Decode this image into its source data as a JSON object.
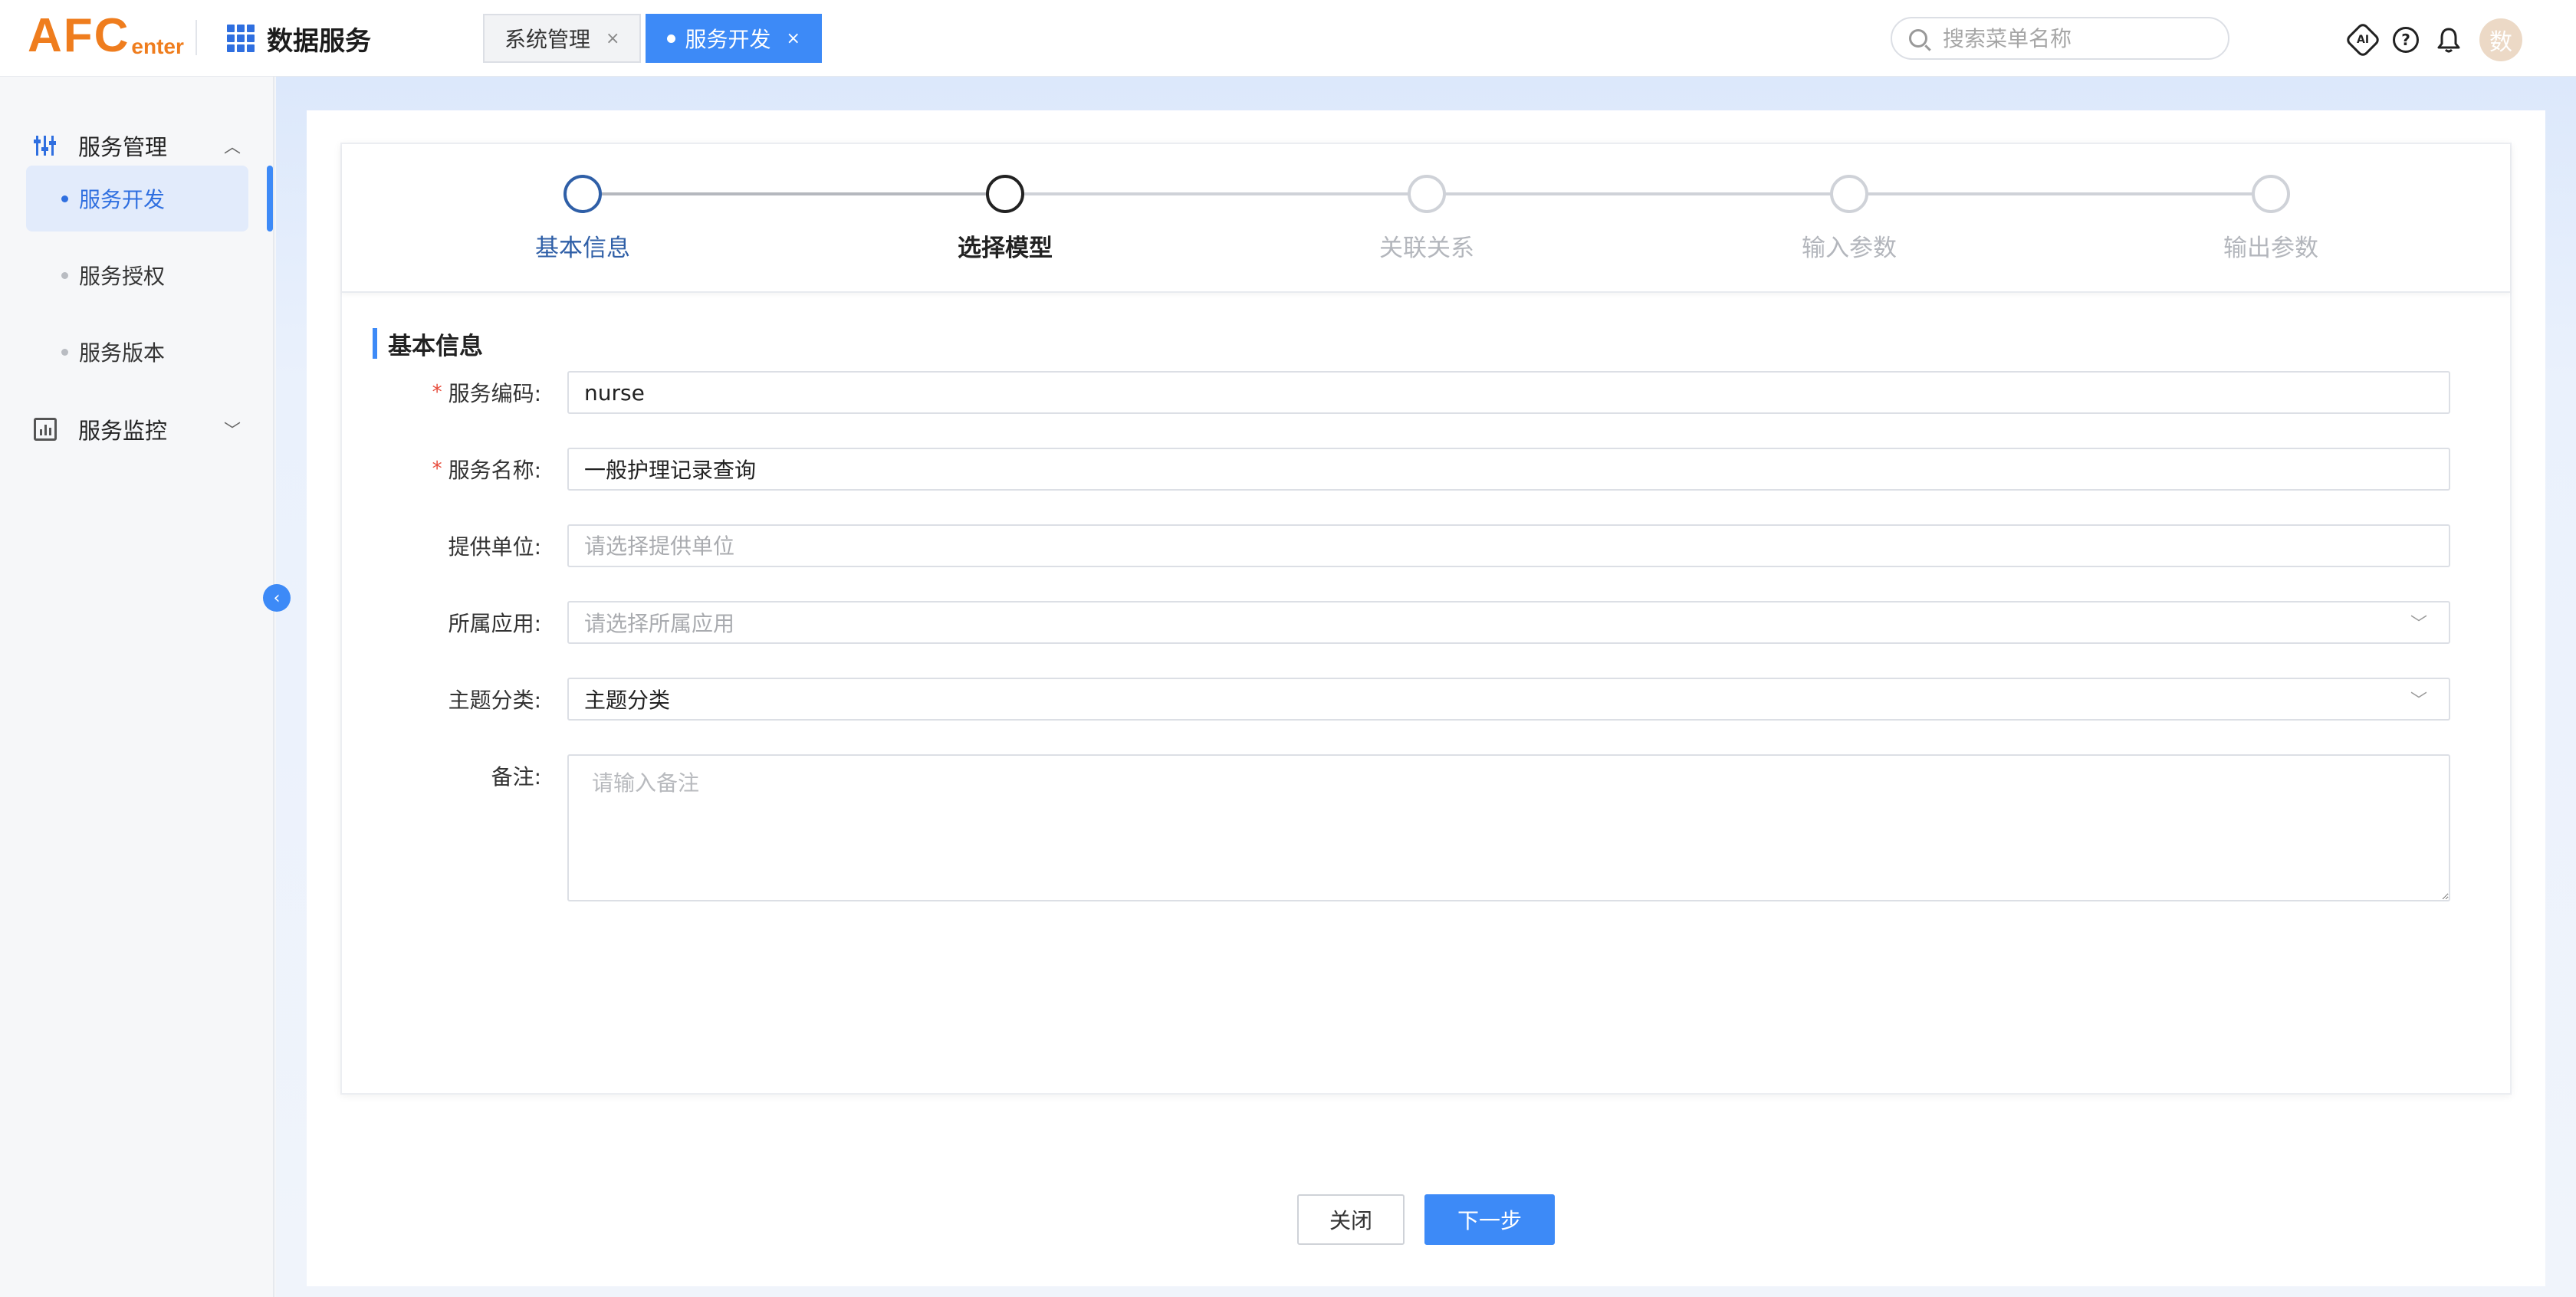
{
  "header": {
    "logo_big": "AFC",
    "logo_small": "enter",
    "app_title": "数据服务",
    "tabs": [
      {
        "label": "系统管理",
        "close": "×"
      },
      {
        "label": "服务开发",
        "close": "×"
      }
    ],
    "search_placeholder": "搜索菜单名称",
    "ai_label": "AI",
    "help_label": "?",
    "avatar_text": "数"
  },
  "sidebar": {
    "groups": [
      {
        "label": "服务管理",
        "chevron": "︿"
      },
      {
        "label": "服务监控",
        "chevron": "﹀"
      }
    ],
    "items": [
      {
        "label": "服务开发"
      },
      {
        "label": "服务授权"
      },
      {
        "label": "服务版本"
      }
    ],
    "collapse_icon": "‹"
  },
  "steps": [
    {
      "label": "基本信息"
    },
    {
      "label": "选择模型"
    },
    {
      "label": "关联关系"
    },
    {
      "label": "输入参数"
    },
    {
      "label": "输出参数"
    }
  ],
  "form": {
    "section_title": "基本信息",
    "required_mark": "*",
    "fields": [
      {
        "label": "服务编码:",
        "value": "nurse"
      },
      {
        "label": "服务名称:",
        "value": "一般护理记录查询"
      },
      {
        "label": "提供单位:",
        "placeholder": "请选择提供单位"
      },
      {
        "label": "所属应用:",
        "placeholder": "请选择所属应用"
      },
      {
        "label": "主题分类:",
        "value": "主题分类"
      },
      {
        "label": "备注:",
        "placeholder": "请输入备注"
      }
    ],
    "dropdown_glyph": "﹀"
  },
  "buttons": {
    "close": "关闭",
    "next": "下一步"
  },
  "colors": {
    "accent": "#3d8af7",
    "logo": "#ef7d1e",
    "step_done": "#2f5fa7",
    "required": "#e74c3c"
  }
}
